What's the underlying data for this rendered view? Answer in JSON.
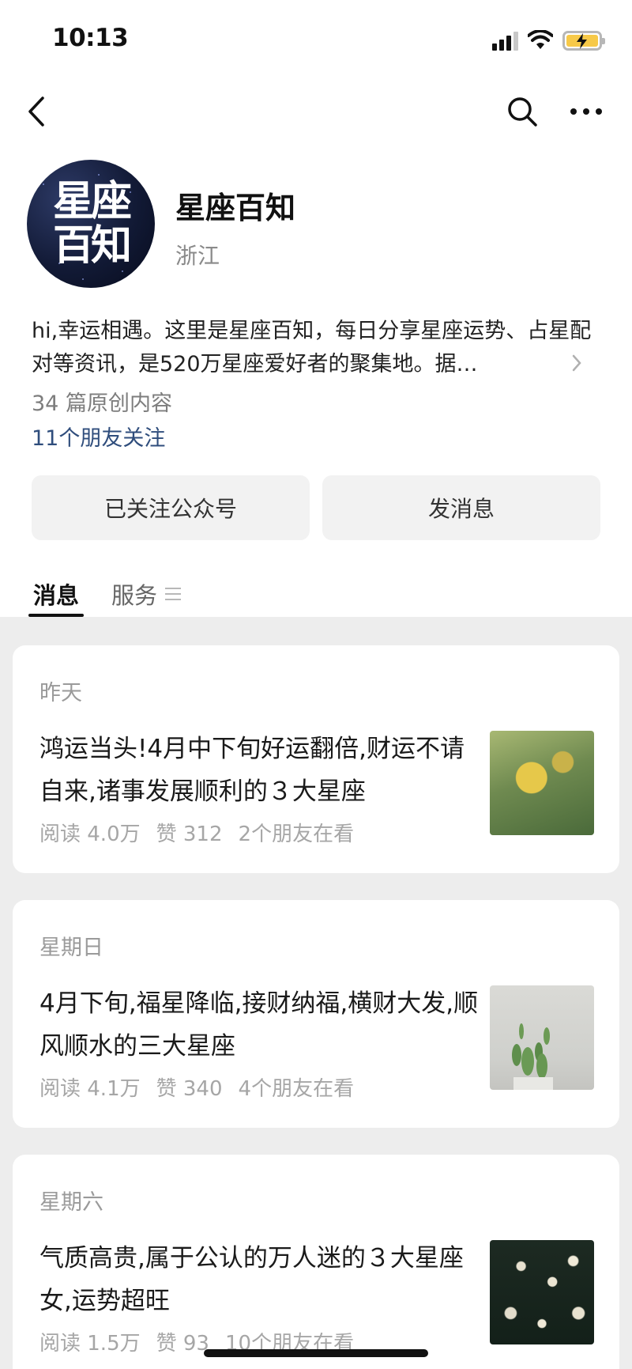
{
  "status_bar": {
    "time": "10:13"
  },
  "account": {
    "avatar_text_line1": "星座",
    "avatar_text_line2": "百知",
    "name": "星座百知",
    "region": "浙江",
    "description": "hi,幸运相遇。这里是星座百知，每日分享星座运势、占星配对等资讯，是520万星座爱好者的聚集地。据…",
    "original_count": "34 篇原创内容",
    "friends_following": "11个朋友关注"
  },
  "actions": {
    "follow_label": "已关注公众号",
    "message_label": "发消息"
  },
  "tabs": [
    {
      "label": "消息",
      "active": true
    },
    {
      "label": "服务",
      "active": false
    }
  ],
  "articles": [
    {
      "day": "昨天",
      "title": "鸿运当头!4月中下旬好运翻倍,财运不请自来,诸事发展顺利的３大星座",
      "reads": "阅读 4.0万",
      "likes": "赞 312",
      "friends": "2个朋友在看",
      "thumbnail_icon": "daffodil-photo"
    },
    {
      "day": "星期日",
      "title": "4月下旬,福星降临,接财纳福,横财大发,顺风顺水的三大星座",
      "reads": "阅读 4.1万",
      "likes": "赞 340",
      "friends": "4个朋友在看",
      "thumbnail_icon": "cactus-photo"
    },
    {
      "day": "星期六",
      "title": "气质高贵,属于公认的万人迷的３大星座女,运势超旺",
      "reads": "阅读 1.5万",
      "likes": "赞 93",
      "friends": "10个朋友在看",
      "thumbnail_icon": "white-flowers-photo"
    }
  ],
  "colors": {
    "accent_link": "#2f4d7c",
    "battery": "#f7c948",
    "page_background": "#ededed"
  }
}
